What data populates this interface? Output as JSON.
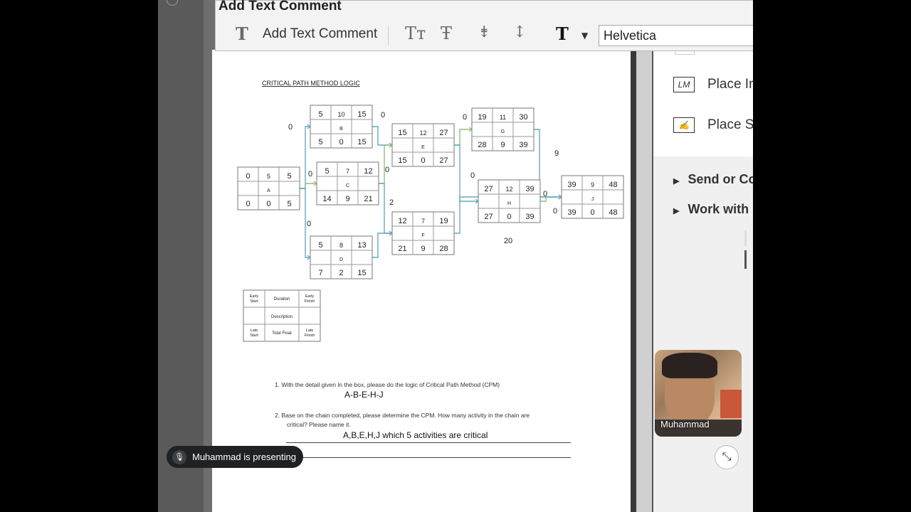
{
  "toolbar": {
    "window_title": "Add Text Comment",
    "add_text_label": "Add Text Comment",
    "font_name": "Helvetica"
  },
  "side_panel": {
    "place_initial_label": "Place In",
    "place_initial_icon_text": "LM",
    "place_signature_label": "Place Sig",
    "send_label": "Send or Co",
    "work_label": "Work with"
  },
  "document": {
    "heading": "CRITICAL PATH METHOD LOGIC",
    "nodes": [
      {
        "id": "A",
        "es": "0",
        "dur": "5",
        "ef": "5",
        "ls": "0",
        "tf": "0",
        "lf": "5"
      },
      {
        "id": "B",
        "es": "5",
        "dur": "10",
        "ef": "15",
        "ls": "5",
        "tf": "0",
        "lf": "15"
      },
      {
        "id": "C",
        "es": "5",
        "dur": "7",
        "ef": "12",
        "ls": "14",
        "tf": "9",
        "lf": "21"
      },
      {
        "id": "D",
        "es": "5",
        "dur": "8",
        "ef": "13",
        "ls": "7",
        "tf": "2",
        "lf": "15"
      },
      {
        "id": "E",
        "es": "15",
        "dur": "12",
        "ef": "27",
        "ls": "15",
        "tf": "0",
        "lf": "27"
      },
      {
        "id": "F",
        "es": "12",
        "dur": "7",
        "ef": "19",
        "ls": "21",
        "tf": "9",
        "lf": "28"
      },
      {
        "id": "G",
        "es": "19",
        "dur": "11",
        "ef": "30",
        "ls": "28",
        "tf": "9",
        "lf": "39"
      },
      {
        "id": "H",
        "es": "27",
        "dur": "12",
        "ef": "39",
        "ls": "27",
        "tf": "0",
        "lf": "39"
      },
      {
        "id": "J",
        "es": "39",
        "dur": "9",
        "ef": "48",
        "ls": "39",
        "tf": "0",
        "lf": "48"
      }
    ],
    "arrow_labels": [
      "0",
      "0",
      "0",
      "0",
      "0",
      "2",
      "0",
      "0",
      "0",
      "9",
      "0",
      "20"
    ],
    "legend": {
      "early_start": "Early Start",
      "duration": "Duration",
      "early_finish": "Early Finish",
      "description": "Description",
      "late_start": "Late Start",
      "total_float": "Total Float",
      "late_finish": "Late Finish"
    },
    "question1": "1.   With the detail given in the box, please do the logic of Critical Path Method (CPM)",
    "answer1": "A-B-E-H-J",
    "question2_line1": "2.   Base on the chain completed, please determine the CPM. How many activity in the chain are",
    "question2_line2": "critical? Please name it.",
    "answer2": "A,B,E,H,J which 5 activities are critical"
  },
  "meeting": {
    "presenting_text": "Muhammad is presenting",
    "participant_name": "Muhammad"
  }
}
